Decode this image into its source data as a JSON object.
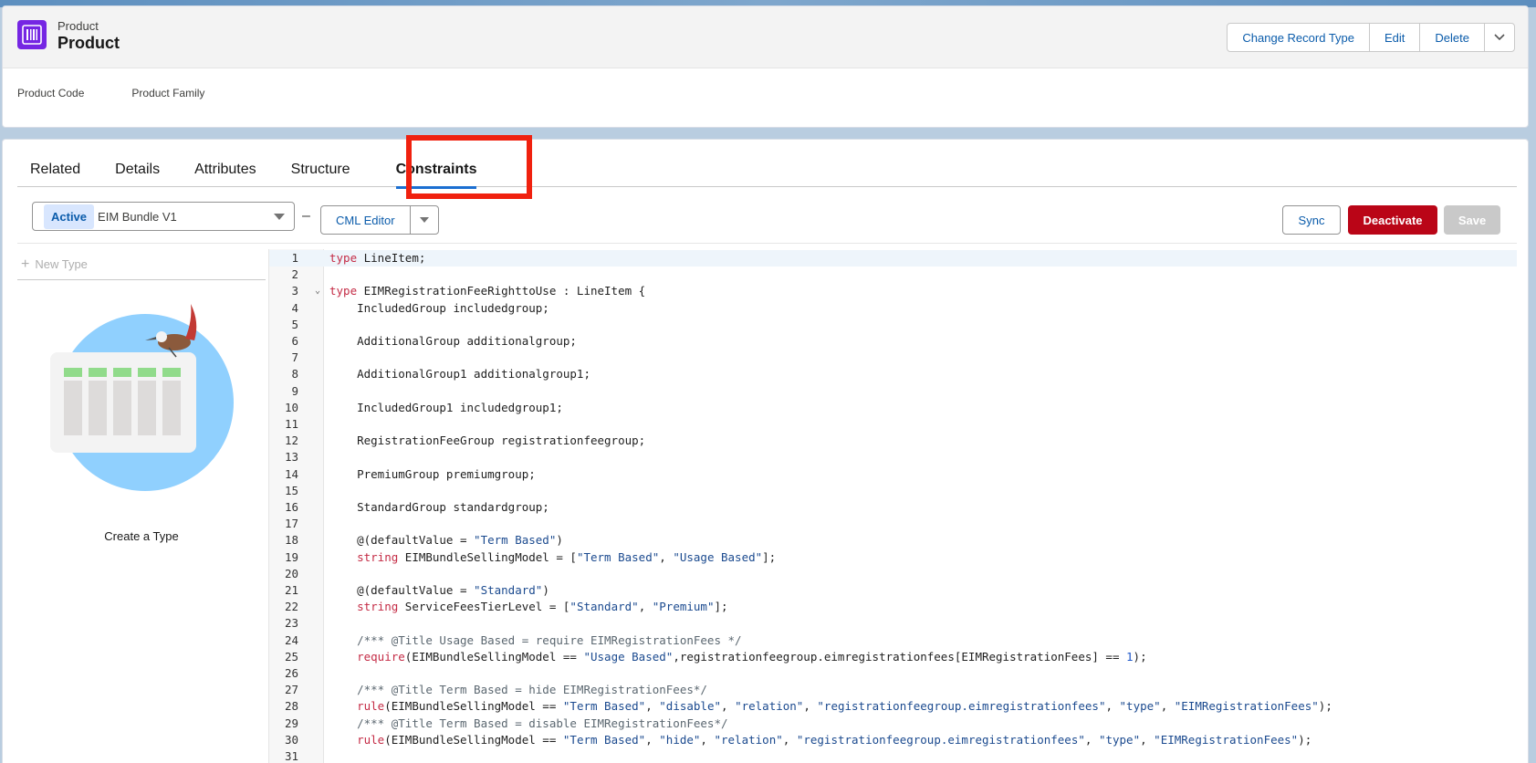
{
  "header": {
    "object_label": "Product",
    "record_name": "Product",
    "buttons": [
      "Change Record Type",
      "Edit",
      "Delete"
    ],
    "fields": [
      "Product Code",
      "Product Family"
    ]
  },
  "tabs": [
    "Related",
    "Details",
    "Attributes",
    "Structure",
    "Constraints"
  ],
  "active_tab": "Constraints",
  "toolbar": {
    "status_badge": "Active",
    "version_name": "EIM Bundle V1",
    "dash": "–",
    "editor_mode": "CML Editor",
    "sync_label": "Sync",
    "deactivate_label": "Deactivate",
    "save_label": "Save"
  },
  "left_panel": {
    "new_type_label": "New Type",
    "create_type_label": "Create a Type"
  },
  "code_lines": [
    {
      "n": "1",
      "html": "<span class='kw'>type</span> LineItem;"
    },
    {
      "n": "2",
      "html": ""
    },
    {
      "n": "3",
      "html": "<span class='kw'>type</span> EIMRegistrationFeeRighttoUse : LineItem {",
      "fold": true
    },
    {
      "n": "4",
      "html": "    IncludedGroup includedgroup;"
    },
    {
      "n": "5",
      "html": ""
    },
    {
      "n": "6",
      "html": "    AdditionalGroup additionalgroup;"
    },
    {
      "n": "7",
      "html": ""
    },
    {
      "n": "8",
      "html": "    AdditionalGroup1 additionalgroup1;"
    },
    {
      "n": "9",
      "html": ""
    },
    {
      "n": "10",
      "html": "    IncludedGroup1 includedgroup1;"
    },
    {
      "n": "11",
      "html": ""
    },
    {
      "n": "12",
      "html": "    RegistrationFeeGroup registrationfeegroup;"
    },
    {
      "n": "13",
      "html": ""
    },
    {
      "n": "14",
      "html": "    PremiumGroup premiumgroup;"
    },
    {
      "n": "15",
      "html": ""
    },
    {
      "n": "16",
      "html": "    StandardGroup standardgroup;"
    },
    {
      "n": "17",
      "html": ""
    },
    {
      "n": "18",
      "html": "    @(defaultValue = <span class='str'>\"Term Based\"</span>)"
    },
    {
      "n": "19",
      "html": "    <span class='kw'>string</span> EIMBundleSellingModel = [<span class='str'>\"Term Based\"</span>, <span class='str'>\"Usage Based\"</span>];"
    },
    {
      "n": "20",
      "html": ""
    },
    {
      "n": "21",
      "html": "    @(defaultValue = <span class='str'>\"Standard\"</span>)"
    },
    {
      "n": "22",
      "html": "    <span class='kw'>string</span> ServiceFeesTierLevel = [<span class='str'>\"Standard\"</span>, <span class='str'>\"Premium\"</span>];"
    },
    {
      "n": "23",
      "html": ""
    },
    {
      "n": "24",
      "html": "    <span class='cm'>/*** @Title Usage Based = require EIMRegistrationFees */</span>"
    },
    {
      "n": "25",
      "html": "    <span class='kw'>require</span>(EIMBundleSellingModel == <span class='str'>\"Usage Based\"</span>,registrationfeegroup.eimregistrationfees[EIMRegistrationFees] == <span class='num'>1</span>);"
    },
    {
      "n": "26",
      "html": ""
    },
    {
      "n": "27",
      "html": "    <span class='cm'>/*** @Title Term Based = hide EIMRegistrationFees*/</span>"
    },
    {
      "n": "28",
      "html": "    <span class='kw'>rule</span>(EIMBundleSellingModel == <span class='str'>\"Term Based\"</span>, <span class='str'>\"disable\"</span>, <span class='str'>\"relation\"</span>, <span class='str'>\"registrationfeegroup.eimregistrationfees\"</span>, <span class='str'>\"type\"</span>, <span class='str'>\"EIMRegistrationFees\"</span>);"
    },
    {
      "n": "29",
      "html": "    <span class='cm'>/*** @Title Term Based = disable EIMRegistrationFees*/</span>"
    },
    {
      "n": "30",
      "html": "    <span class='kw'>rule</span>(EIMBundleSellingModel == <span class='str'>\"Term Based\"</span>, <span class='str'>\"hide\"</span>, <span class='str'>\"relation\"</span>, <span class='str'>\"registrationfeegroup.eimregistrationfees\"</span>, <span class='str'>\"type\"</span>, <span class='str'>\"EIMRegistrationFees\"</span>);"
    },
    {
      "n": "31",
      "html": ""
    }
  ]
}
